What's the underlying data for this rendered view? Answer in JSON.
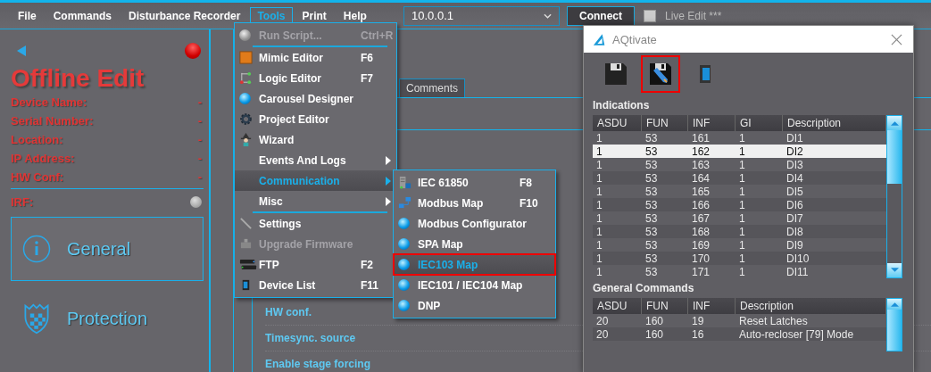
{
  "menubar": [
    {
      "label": "File",
      "selected": false
    },
    {
      "label": "Commands",
      "selected": false
    },
    {
      "label": "Disturbance Recorder",
      "selected": false
    },
    {
      "label": "Tools",
      "selected": true
    },
    {
      "label": "Print",
      "selected": false
    },
    {
      "label": "Help",
      "selected": false
    }
  ],
  "address": {
    "value": "10.0.0.1"
  },
  "connect_button": "Connect",
  "live_edit": {
    "label": "Live Edit ***",
    "checked": false
  },
  "status_panel": {
    "title": "Offline Edit",
    "fields": [
      {
        "label": "Device Name:",
        "value": "-"
      },
      {
        "label": "Serial Number:",
        "value": "-"
      },
      {
        "label": "Location:",
        "value": "-"
      },
      {
        "label": "IP Address:",
        "value": "-"
      },
      {
        "label": "HW Conf:",
        "value": "-"
      }
    ],
    "irf_label": "IRF:"
  },
  "nav": [
    {
      "label": "General",
      "selected": true
    },
    {
      "label": "Protection",
      "selected": false
    }
  ],
  "content": {
    "tabs": [
      {
        "label": "Comments",
        "selected": false
      }
    ],
    "rows": [
      "HW conf.",
      "Timesync. source",
      "Enable stage forcing"
    ]
  },
  "tools_menu": [
    {
      "kind": "item",
      "label": "Run Script...",
      "shortcut": "Ctrl+R",
      "disabled": true,
      "selected": false,
      "submenu": false
    },
    {
      "kind": "separator"
    },
    {
      "kind": "item",
      "label": "Mimic Editor",
      "shortcut": "F6",
      "disabled": false,
      "selected": false,
      "submenu": false
    },
    {
      "kind": "item",
      "label": "Logic Editor",
      "shortcut": "F7",
      "disabled": false,
      "selected": false,
      "submenu": false
    },
    {
      "kind": "item",
      "label": "Carousel Designer",
      "disabled": false,
      "selected": false,
      "submenu": false
    },
    {
      "kind": "item",
      "label": "Project Editor",
      "disabled": false,
      "selected": false,
      "submenu": false
    },
    {
      "kind": "item",
      "label": "Wizard",
      "disabled": false,
      "selected": false,
      "submenu": false
    },
    {
      "kind": "item",
      "label": "Events And Logs",
      "disabled": false,
      "selected": false,
      "submenu": true
    },
    {
      "kind": "item",
      "label": "Communication",
      "disabled": false,
      "selected": true,
      "submenu": true
    },
    {
      "kind": "item",
      "label": "Misc",
      "disabled": false,
      "selected": false,
      "submenu": true
    },
    {
      "kind": "separator"
    },
    {
      "kind": "item",
      "label": "Settings",
      "disabled": false,
      "selected": false,
      "submenu": false
    },
    {
      "kind": "item",
      "label": "Upgrade Firmware",
      "disabled": true,
      "selected": false,
      "submenu": false
    },
    {
      "kind": "item",
      "label": "FTP",
      "shortcut": "F2",
      "disabled": false,
      "selected": false,
      "submenu": false
    },
    {
      "kind": "item",
      "label": "Device List",
      "shortcut": "F11",
      "disabled": false,
      "selected": false,
      "submenu": false
    }
  ],
  "communication_menu": [
    {
      "label": "IEC 61850",
      "shortcut": "F8",
      "selected": false
    },
    {
      "label": "Modbus Map",
      "shortcut": "F10",
      "selected": false
    },
    {
      "label": "Modbus Configurator",
      "selected": false
    },
    {
      "label": "SPA Map",
      "selected": false
    },
    {
      "label": "IEC103 Map",
      "selected": true
    },
    {
      "label": "IEC101 / IEC104 Map",
      "selected": false
    },
    {
      "label": "DNP",
      "selected": false
    }
  ],
  "dialog": {
    "title": "AQtivate",
    "toolbar": [
      {
        "selected": false
      },
      {
        "selected": true
      },
      {
        "selected": false
      }
    ],
    "sections": [
      {
        "title": "Indications",
        "columns": [
          "ASDU",
          "FUN",
          "INF",
          "GI",
          "Description"
        ],
        "rows": [
          {
            "cells": [
              "1",
              "53",
              "161",
              "1",
              "DI1"
            ],
            "selected": false
          },
          {
            "cells": [
              "1",
              "53",
              "162",
              "1",
              "DI2"
            ],
            "selected": true
          },
          {
            "cells": [
              "1",
              "53",
              "163",
              "1",
              "DI3"
            ],
            "selected": false
          },
          {
            "cells": [
              "1",
              "53",
              "164",
              "1",
              "DI4"
            ],
            "selected": false
          },
          {
            "cells": [
              "1",
              "53",
              "165",
              "1",
              "DI5"
            ],
            "selected": false
          },
          {
            "cells": [
              "1",
              "53",
              "166",
              "1",
              "DI6"
            ],
            "selected": false
          },
          {
            "cells": [
              "1",
              "53",
              "167",
              "1",
              "DI7"
            ],
            "selected": false
          },
          {
            "cells": [
              "1",
              "53",
              "168",
              "1",
              "DI8"
            ],
            "selected": false
          },
          {
            "cells": [
              "1",
              "53",
              "169",
              "1",
              "DI9"
            ],
            "selected": false
          },
          {
            "cells": [
              "1",
              "53",
              "170",
              "1",
              "DI10"
            ],
            "selected": false
          },
          {
            "cells": [
              "1",
              "53",
              "171",
              "1",
              "DI11"
            ],
            "selected": false
          }
        ]
      },
      {
        "title": "General Commands",
        "columns": [
          "ASDU",
          "FUN",
          "INF",
          "Description"
        ],
        "rows": [
          {
            "cells": [
              "20",
              "160",
              "19",
              "Reset Latches"
            ],
            "selected": false
          },
          {
            "cells": [
              "20",
              "160",
              "16",
              "Auto-recloser [79] Mode"
            ],
            "selected": false
          }
        ]
      }
    ]
  }
}
